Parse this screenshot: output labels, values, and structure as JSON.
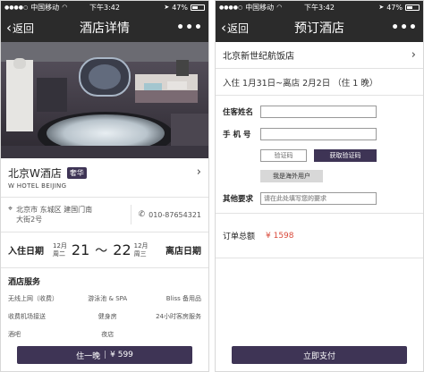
{
  "status": {
    "carrier": "中国移动",
    "time": "下午3:42",
    "battery": "47%",
    "battery_level": 0.47
  },
  "left": {
    "nav": {
      "back": "返回",
      "title": "酒店详情",
      "more": "•••"
    },
    "hotel": {
      "name": "北京W酒店",
      "badge": "奢华",
      "name_en": "W HOTEL BEIJING",
      "address": "北京市 东城区 建国门南大街2号",
      "phone": "010-87654321"
    },
    "dates": {
      "checkin_label": "入住日期",
      "checkin_month": "12月",
      "checkin_weekday": "周二",
      "checkin_day": "21",
      "separator": "～",
      "checkout_day": "22",
      "checkout_month": "12月",
      "checkout_weekday": "周三",
      "checkout_label": "离店日期"
    },
    "services": {
      "heading": "酒店服务",
      "items": [
        "无线上网（收费）",
        "游泳池 & SPA",
        "Bliss 备用品",
        "收费机场接送",
        "健身房",
        "24小时客房服务",
        "酒吧",
        "夜店"
      ]
    },
    "book_button": {
      "nights": "住一晚",
      "price": "¥ 599"
    }
  },
  "right": {
    "nav": {
      "back": "返回",
      "title": "预订酒店",
      "more": "•••"
    },
    "hotel_name": "北京新世纪航饭店",
    "stay_info": "入住 1月31日~离店 2月2日 （住 1 晚）",
    "form": {
      "guest_label": "住客姓名",
      "guest_value": "",
      "phone_label": "手 机 号",
      "phone_value": "",
      "code_placeholder": "验证码",
      "get_code_button": "获取验证码",
      "overseas_button": "我是海外用户",
      "other_label": "其他要求",
      "other_placeholder": "请在此处填写您的要求"
    },
    "total_label": "订单总额",
    "total_value": "¥ 1598",
    "pay_button": "立即支付"
  },
  "colors": {
    "nav_bg": "#2b2b2b",
    "accent": "#3e3455",
    "price_red": "#d9493a"
  }
}
